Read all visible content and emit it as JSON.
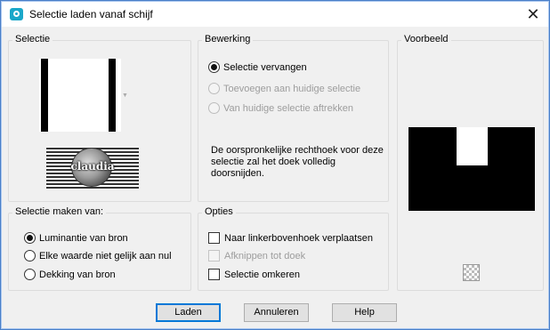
{
  "window": {
    "title": "Selectie laden vanaf schijf",
    "icon": "selection-app-icon",
    "close_glyph": "✕"
  },
  "selectie": {
    "label": "Selectie",
    "thumbnail_icon": "selection-thumbnail",
    "dropdown_icon": "dropdown-arrow-icon",
    "watermark_text": "claudia"
  },
  "bewerking": {
    "label": "Bewerking",
    "options": [
      {
        "label": "Selectie vervangen",
        "checked": true,
        "enabled": true
      },
      {
        "label": "Toevoegen aan huidige selectie",
        "checked": false,
        "enabled": false
      },
      {
        "label": "Van huidige selectie aftrekken",
        "checked": false,
        "enabled": false
      }
    ],
    "note": "De oorspronkelijke rechthoek voor deze selectie zal het doek volledig doorsnijden."
  },
  "voorbeeld": {
    "label": "Voorbeeld",
    "preview_icon": "selection-preview",
    "zoom_icon": "checkerboard-icon"
  },
  "maken_van": {
    "label": "Selectie maken van:",
    "options": [
      {
        "label": "Luminantie van bron",
        "checked": true
      },
      {
        "label": "Elke waarde niet gelijk aan nul",
        "checked": false
      },
      {
        "label": "Dekking van bron",
        "checked": false
      }
    ]
  },
  "opties": {
    "label": "Opties",
    "items": [
      {
        "label": "Naar linkerbovenhoek verplaatsen",
        "checked": false,
        "enabled": true
      },
      {
        "label": "Afknippen tot doek",
        "checked": false,
        "enabled": false
      },
      {
        "label": "Selectie omkeren",
        "checked": false,
        "enabled": true
      }
    ]
  },
  "buttons": {
    "ok": "Laden",
    "cancel": "Annuleren",
    "help": "Help"
  },
  "colors": {
    "accent": "#0078d7",
    "frame": "#4a7fc8",
    "dialog_bg": "#f0f0f0"
  }
}
